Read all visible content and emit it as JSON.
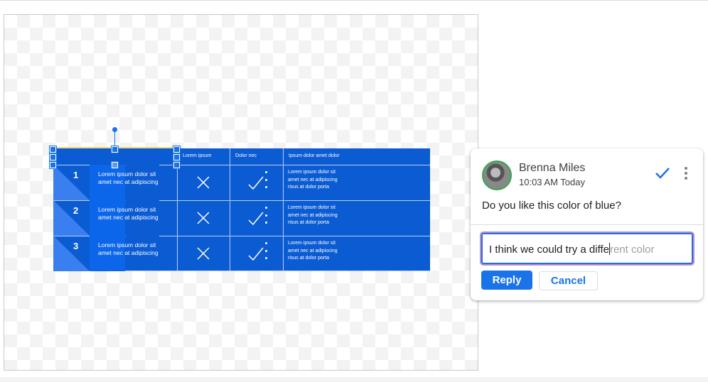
{
  "table": {
    "headers": [
      "",
      "Lorem ipsum",
      "Dolor nec",
      "Ipsum dolor amet dolor"
    ],
    "rows": [
      {
        "number": "1",
        "text1": "Lorem ipsum dolor sit",
        "text2": "amet nec at adipiscing",
        "col2": "x",
        "col3": "check",
        "bullets": [
          "Lorem ipsum dolor sit",
          "amet nec at adipiscing",
          "risus at dolor porta"
        ]
      },
      {
        "number": "2",
        "text1": "Lorem ipsum dolor sit",
        "text2": "amet nec at adipiscing",
        "col2": "x",
        "col3": "check",
        "bullets": [
          "Lorem ipsum dolor sit",
          "amet nec at adipiscing",
          "risus at dolor porta"
        ]
      },
      {
        "number": "3",
        "text1": "Lorem ipsum dolor sit",
        "text2": "amet nec at adipiscing",
        "col2": "x",
        "col3": "check",
        "bullets": [
          "Lorem ipsum dolor sit",
          "amet nec at adipiscing",
          "risus at dolor porta"
        ]
      }
    ],
    "colors": {
      "fill": "#0b5bd3",
      "band": "#0c66ea",
      "triangle": "#3a7ff0"
    }
  },
  "comment": {
    "author": "Brenna Miles",
    "time": "10:03 AM Today",
    "message": "Do you like this color of blue?",
    "reply_typed": "I think we could try a diffe",
    "reply_suggestion": "rent color",
    "reply_label": "Reply",
    "cancel_label": "Cancel",
    "resolve_icon": "check-icon",
    "more_icon": "more-vert-icon",
    "accent": "#1a73e8"
  }
}
